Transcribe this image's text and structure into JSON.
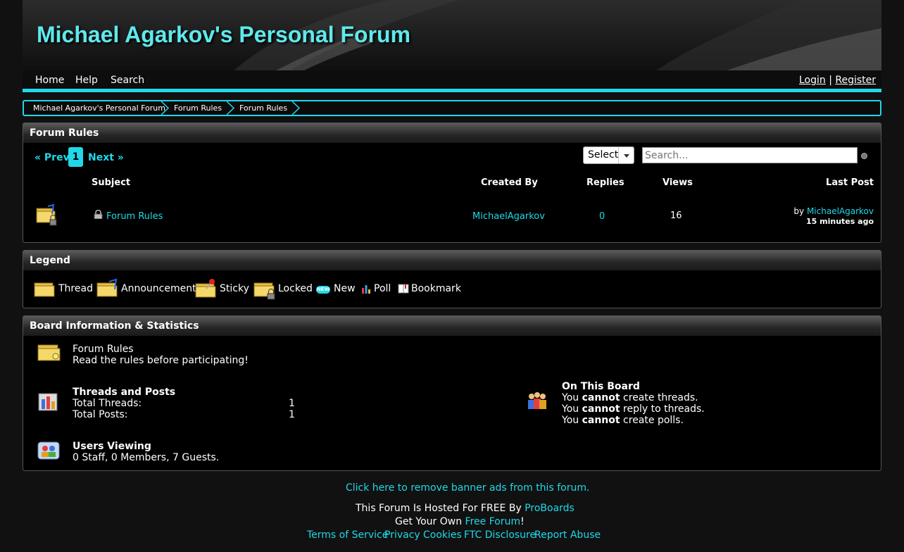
{
  "header": {
    "title": "Michael Agarkov's Personal Forum"
  },
  "nav": {
    "home": "Home",
    "help": "Help",
    "search": "Search",
    "login": "Login",
    "separator": "|",
    "register": "Register"
  },
  "breadcrumb": [
    "Michael Agarkov's Personal Forum",
    "Forum Rules",
    "Forum Rules"
  ],
  "board": {
    "title": "Forum Rules",
    "pager": {
      "prev": "« Prev",
      "current": "1",
      "next": "Next »"
    },
    "select_label": "Select",
    "search_placeholder": "Search...",
    "columns": {
      "subject": "Subject",
      "created_by": "Created By",
      "replies": "Replies",
      "views": "Views",
      "last_post": "Last Post"
    },
    "threads": [
      {
        "subject": "Forum Rules",
        "created_by": "MichaelAgarkov",
        "replies": "0",
        "views": "16",
        "last_post_by_prefix": "by",
        "last_post_by": "MichaelAgarkov",
        "last_post_time": "15 minutes ago"
      }
    ]
  },
  "legend": {
    "title": "Legend",
    "items": {
      "thread": "Thread",
      "announcement": "Announcement",
      "sticky": "Sticky",
      "locked": "Locked",
      "new": "New",
      "new_badge": "NEW",
      "poll": "Poll",
      "bookmark": "Bookmark"
    }
  },
  "stats": {
    "title": "Board Information & Statistics",
    "board_name": "Forum Rules",
    "board_desc": "Read the rules before participating!",
    "threads_posts_title": "Threads and Posts",
    "total_threads_label": "Total Threads:",
    "total_threads": "1",
    "total_posts_label": "Total Posts:",
    "total_posts": "1",
    "on_board_title": "On This Board",
    "perm_you": "You",
    "perm_cannot": "cannot",
    "perm_create_threads": "create threads.",
    "perm_reply": "reply to threads.",
    "perm_polls": "create polls.",
    "users_viewing_title": "Users Viewing",
    "users_viewing": "0 Staff, 0 Members, 7 Guests."
  },
  "footer": {
    "remove_ads": "Click here to remove banner ads from this forum.",
    "hosted_prefix": "This Forum Is Hosted For FREE By ",
    "hosted_link": "ProBoards",
    "own_prefix": "Get Your Own ",
    "own_link": "Free Forum",
    "own_suffix": "!",
    "links": [
      "Terms of Service",
      "Privacy",
      "Cookies",
      "FTC Disclosure",
      "Report Abuse"
    ]
  },
  "colors": {
    "accent": "#20d8e8",
    "title": "#5ee9ec",
    "background": "#111111"
  }
}
